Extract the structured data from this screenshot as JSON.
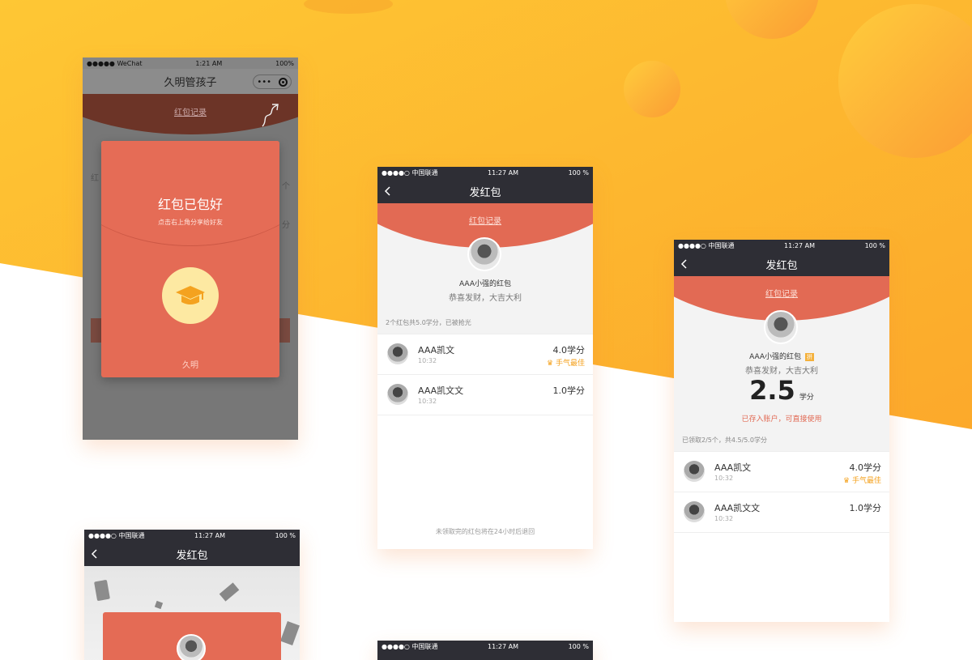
{
  "colors": {
    "accent": "#e26a54",
    "yellow": "#fec030",
    "nav": "#2e2e35",
    "gold": "#f4a21f"
  },
  "screen1": {
    "status": {
      "signal": "●●●●● WeChat",
      "time": "1:21 AM",
      "battery": "100%"
    },
    "title": "久明管孩子",
    "record_link": "红包记录",
    "card": {
      "title": "红包已包好",
      "subtitle": "点击右上角分享给好友",
      "footer": "久明",
      "icon": "graduation-cap-icon"
    },
    "side": [
      "个",
      "分"
    ]
  },
  "screen2": {
    "status": {
      "carrier": "●●●●○ 中国联通",
      "time": "11:27 AM",
      "battery": "100 %"
    },
    "title": "发红包",
    "record_link": "红包记录",
    "sender": "AAA小强的红包",
    "greeting": "恭喜发财，大吉大利",
    "summary": "2个红包共5.0学分，已被抢光",
    "rows": [
      {
        "name": "AAA凯文",
        "time": "10:32",
        "amount": "4.0学分",
        "badge": "手气最佳"
      },
      {
        "name": "AAA凯文文",
        "time": "10:32",
        "amount": "1.0学分",
        "badge": ""
      }
    ],
    "footer": "未领取完的红包将在24小时后退回"
  },
  "screen3": {
    "status": {
      "carrier": "●●●●○ 中国联通",
      "time": "11:27 AM",
      "battery": "100 %"
    },
    "title": "发红包",
    "record_link": "红包记录",
    "sender": "AAA小强的红包",
    "tag": "拼",
    "greeting": "恭喜发财，大吉大利",
    "amount": "2.5",
    "unit": "学分",
    "note": "已存入账户，可直接使用",
    "summary": "已领取2/5个，共4.5/5.0学分",
    "rows": [
      {
        "name": "AAA凯文",
        "time": "10:32",
        "amount": "4.0学分",
        "badge": "手气最佳"
      },
      {
        "name": "AAA凯文文",
        "time": "10:32",
        "amount": "1.0学分",
        "badge": ""
      }
    ]
  },
  "screen4": {
    "status": {
      "carrier": "●●●●○ 中国联通",
      "time": "11:27 AM",
      "battery": "100 %"
    },
    "title": "发红包"
  },
  "screen5": {
    "status": {
      "carrier": "●●●●○ 中国联通",
      "time": "11:27 AM",
      "battery": "100 %"
    }
  }
}
